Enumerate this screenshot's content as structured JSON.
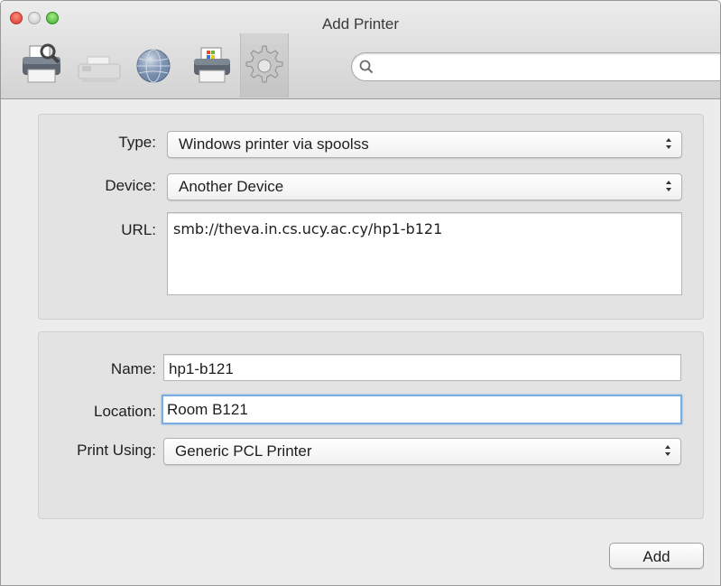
{
  "window": {
    "title": "Add Printer"
  },
  "toolbar": {
    "icons": [
      "default-printer-icon",
      "fax-icon",
      "ip-globe-icon",
      "windows-printer-icon",
      "advanced-gear-icon"
    ],
    "search": {
      "placeholder": "",
      "value": ""
    }
  },
  "connection": {
    "type": {
      "label": "Type:",
      "value": "Windows printer via spoolss"
    },
    "device": {
      "label": "Device:",
      "value": "Another Device"
    },
    "url": {
      "label": "URL:",
      "value": "smb://theva.in.cs.ucy.ac.cy/hp1-b121"
    }
  },
  "details": {
    "name": {
      "label": "Name:",
      "value": "hp1-b121"
    },
    "location": {
      "label": "Location:",
      "value": "Room B121"
    },
    "driver": {
      "label": "Print Using:",
      "value": "Generic PCL Printer"
    }
  },
  "actions": {
    "add_label": "Add"
  },
  "colors": {
    "focus_ring": "#7aaee3",
    "close": "#d6372c",
    "zoom": "#3cae2a"
  }
}
